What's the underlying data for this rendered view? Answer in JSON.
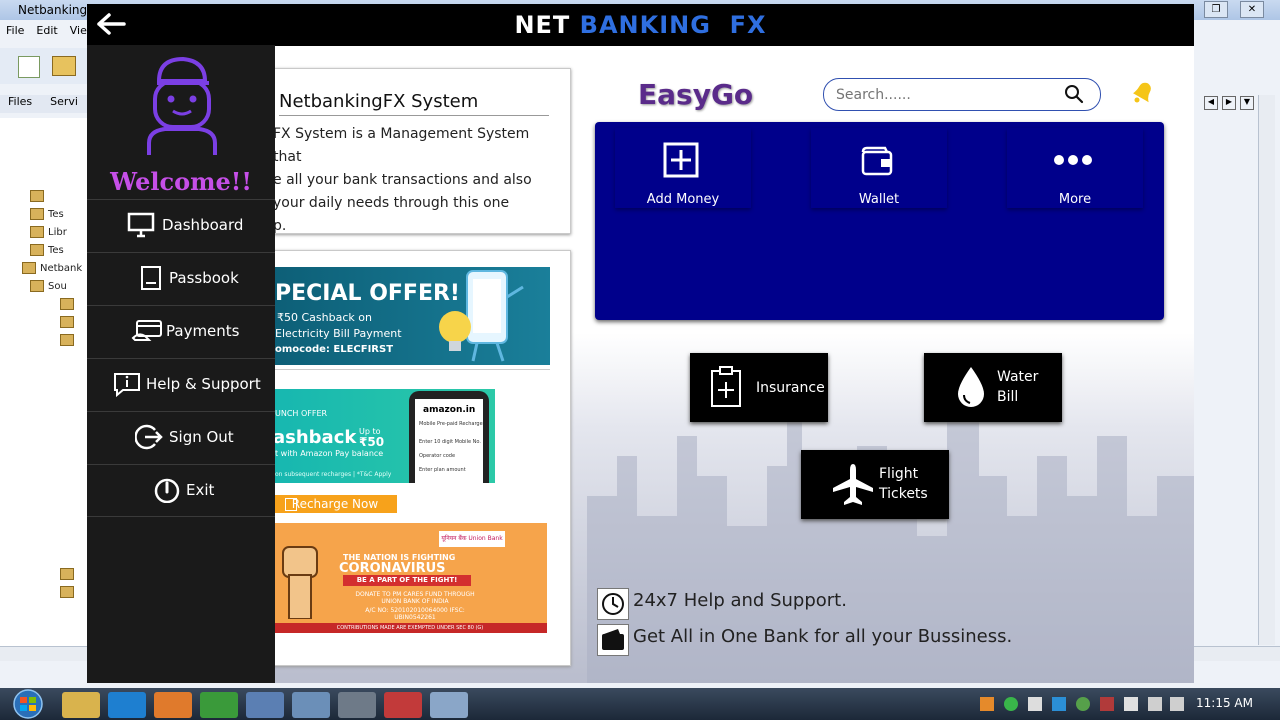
{
  "ide": {
    "window_title": "NetbankingF",
    "menu": [
      "File",
      "Edit",
      "View"
    ],
    "tabs": [
      "Files",
      "Servi"
    ],
    "tree_items": [
      "",
      "Tes",
      "Libr",
      "Tes",
      "Netbanki",
      "Sou",
      "",
      "",
      "",
      "",
      ""
    ]
  },
  "app": {
    "back_label": "Back",
    "title_part1": "NET",
    "title_part2": "BANKING  FX"
  },
  "sidebar": {
    "welcome": "Welcome!!",
    "items": [
      {
        "label": "Dashboard",
        "icon": "monitor-icon"
      },
      {
        "label": "Passbook",
        "icon": "passbook-icon"
      },
      {
        "label": "Payments",
        "icon": "payment-card-icon"
      },
      {
        "label": "Help & Support",
        "icon": "info-chat-icon"
      },
      {
        "label": "Sign Out",
        "icon": "sign-out-icon"
      },
      {
        "label": "Exit",
        "icon": "power-icon"
      }
    ]
  },
  "about": {
    "title": "NetbankingFX System",
    "lines": [
      "FX System is a Management System that",
      "e all your bank transactions and also",
      "your daily needs through this one",
      "p."
    ]
  },
  "offers": {
    "offer1": {
      "title": "PECIAL OFFER!",
      "line1": "₹50 Cashback on",
      "line2": "Electricity Bill Payment",
      "line3": "omocode: ELECFIRST"
    },
    "offer2": {
      "tag": "UNCH OFFER",
      "title": "ashback",
      "upto": "Up to",
      "amount": "₹50",
      "sub": "t with Amazon Pay balance",
      "foot": "on subsequent recharges | *T&C Apply",
      "phone_brand": "amazon.in",
      "phone_l1": "Mobile Pre-paid Recharge",
      "phone_l2": "Enter 10 digit Mobile No.",
      "phone_l3": "Operator code",
      "phone_l4": "Enter plan amount"
    },
    "recharge_label": "Recharge Now",
    "offer3": {
      "logo": "यूनियन बैंक Union Bank",
      "line1": "THE NATION IS FIGHTING",
      "line2": "CORONAVIRUS",
      "line3": "BE A PART OF THE FIGHT!",
      "line4": "DONATE TO PM CARES FUND THROUGH UNION BANK OF INDIA",
      "line5": "A/C NO: 520102010064000 IFSC: UBIN0542261",
      "foot": "CONTRIBUTIONS MADE ARE EXEMPTED UNDER SEC 80 (G)"
    }
  },
  "easygo": {
    "title": "EasyGo",
    "search_placeholder": "Search......",
    "wallet_tiles": [
      {
        "label": "Add Money",
        "icon": "add-money-icon"
      },
      {
        "label": "Wallet",
        "icon": "wallet-icon"
      },
      {
        "label": "More",
        "icon": "more-dots-icon"
      }
    ],
    "services": {
      "insurance": "Insurance",
      "water_l1": "Water",
      "water_l2": "Bill",
      "flight_l1": "Flight",
      "flight_l2": "Tickets"
    },
    "help_text": "24x7 Help and Support.",
    "bank_text": "Get All in One Bank for all your Bussiness."
  },
  "taskbar": {
    "time": "11:15 AM"
  },
  "colors": {
    "header_bg": "#000000",
    "title_accent": "#2f6fe0",
    "sidebar_bg": "#1a1a1a",
    "welcome": "#c64fe8",
    "wallet_panel": "#00008b",
    "easygo": "#5a2b8a"
  }
}
